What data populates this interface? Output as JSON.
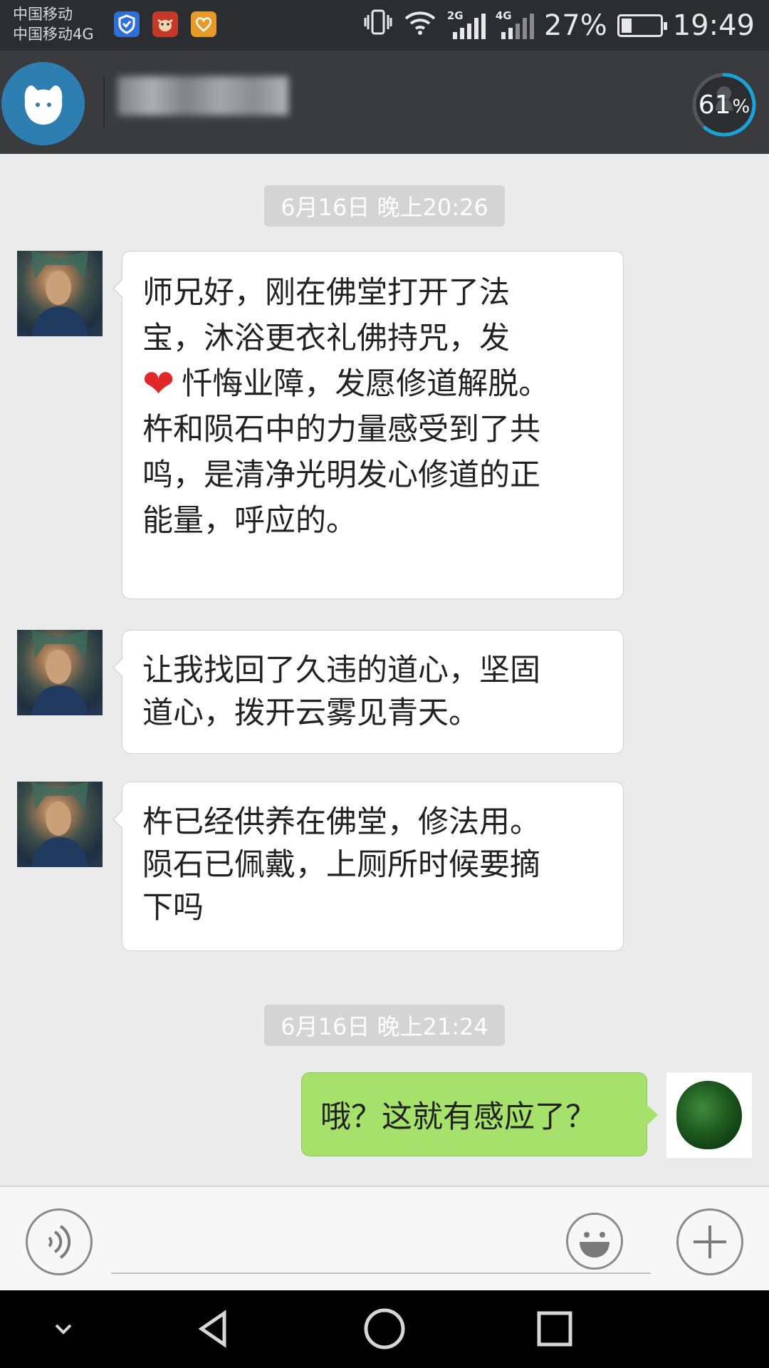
{
  "status_bar": {
    "carrier_1": "中国移动",
    "carrier_2": "中国移动4G",
    "network_1": "2G",
    "network_2": "4G",
    "battery_percent": "27%",
    "battery_level": 0.27,
    "time": "19:49",
    "icons": [
      "shield-app-icon",
      "cow-app-icon",
      "heart-app-icon",
      "vibrate-icon",
      "wifi-icon",
      "signal-icon",
      "battery-icon"
    ]
  },
  "header": {
    "progress_value": "61",
    "progress_unit": "%",
    "progress_level": 0.61,
    "accent_color": "#1aa3d8"
  },
  "chat": {
    "timestamps": [
      "6月16日 晚上20:26",
      "6月16日 晚上21:24"
    ],
    "incoming": [
      {
        "lines": [
          "师兄好，刚在佛堂打开了法",
          "宝，沐浴更衣礼佛持咒，发",
          "忏悔业障，发愿修道解脱。",
          "杵和陨石中的力量感受到了共",
          "鸣，是清净光明发心修道的正",
          "能量，呼应的。"
        ],
        "heart_emoji": "❤"
      },
      {
        "lines": [
          "让我找回了久违的道心，坚固",
          "道心，拨开云雾见青天。"
        ]
      },
      {
        "lines": [
          "杵已经供养在佛堂，修法用。",
          "陨石已佩戴，上厕所时候要摘",
          "下吗"
        ]
      }
    ],
    "outgoing": [
      {
        "text": "哦？这就有感应了？"
      }
    ],
    "bubble_in_color": "#ffffff",
    "bubble_out_color": "#a5e16b"
  },
  "input_bar": {
    "buttons": [
      "voice-button",
      "emoji-button",
      "plus-button"
    ]
  },
  "nav_bar": {
    "buttons": [
      "collapse-button",
      "back-button",
      "home-button",
      "recents-button"
    ]
  }
}
